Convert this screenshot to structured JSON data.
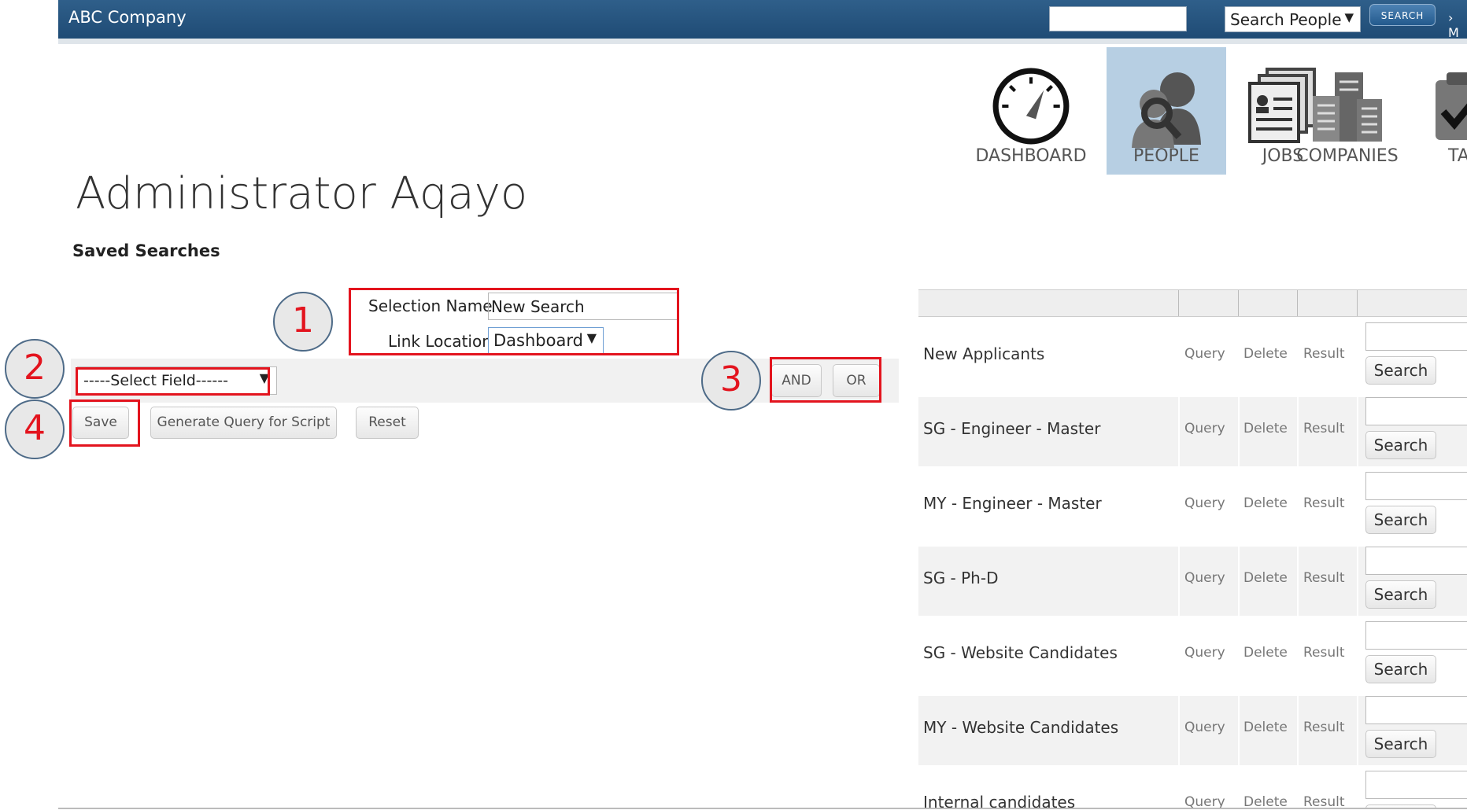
{
  "header": {
    "brand": "ABC Company",
    "search_select_value": "Search People",
    "search_button_label": "SEARCH",
    "more_label": "› M"
  },
  "nav": [
    {
      "label": "DASHBOARD",
      "icon": "dashboard-gauge-icon",
      "active": false
    },
    {
      "label": "PEOPLE",
      "icon": "people-search-icon",
      "active": true
    },
    {
      "label": "JOBS",
      "icon": "jobs-documents-icon",
      "active": false
    },
    {
      "label": "COMPANIES",
      "icon": "companies-buildings-icon",
      "active": false
    },
    {
      "label": "TA",
      "icon": "tasks-clipboard-icon",
      "active": false
    }
  ],
  "page": {
    "title": "Administrator Aqayo",
    "section": "Saved Searches"
  },
  "form": {
    "selection_name_label": "Selection Name",
    "selection_name_value": "New Search",
    "link_location_label": "Link Location",
    "link_location_value": "Dashboard",
    "select_field_value": "-----Select Field------",
    "and_label": "AND",
    "or_label": "OR",
    "save_label": "Save",
    "generate_label": "Generate Query for Script",
    "reset_label": "Reset"
  },
  "annotations": [
    "1",
    "2",
    "3",
    "4"
  ],
  "saved_searches": {
    "query_label": "Query",
    "delete_label": "Delete",
    "result_label": "Result",
    "search_label": "Search",
    "rows": [
      {
        "name": "New Applicants"
      },
      {
        "name": "SG - Engineer - Master"
      },
      {
        "name": "MY - Engineer - Master"
      },
      {
        "name": "SG - Ph-D"
      },
      {
        "name": "SG - Website Candidates"
      },
      {
        "name": "MY - Website Candidates"
      },
      {
        "name": "Internal candidates"
      }
    ]
  },
  "colors": {
    "topbar": "#1f4b75",
    "active_nav": "#b7cfe3",
    "annotation_red": "#e3141e"
  }
}
